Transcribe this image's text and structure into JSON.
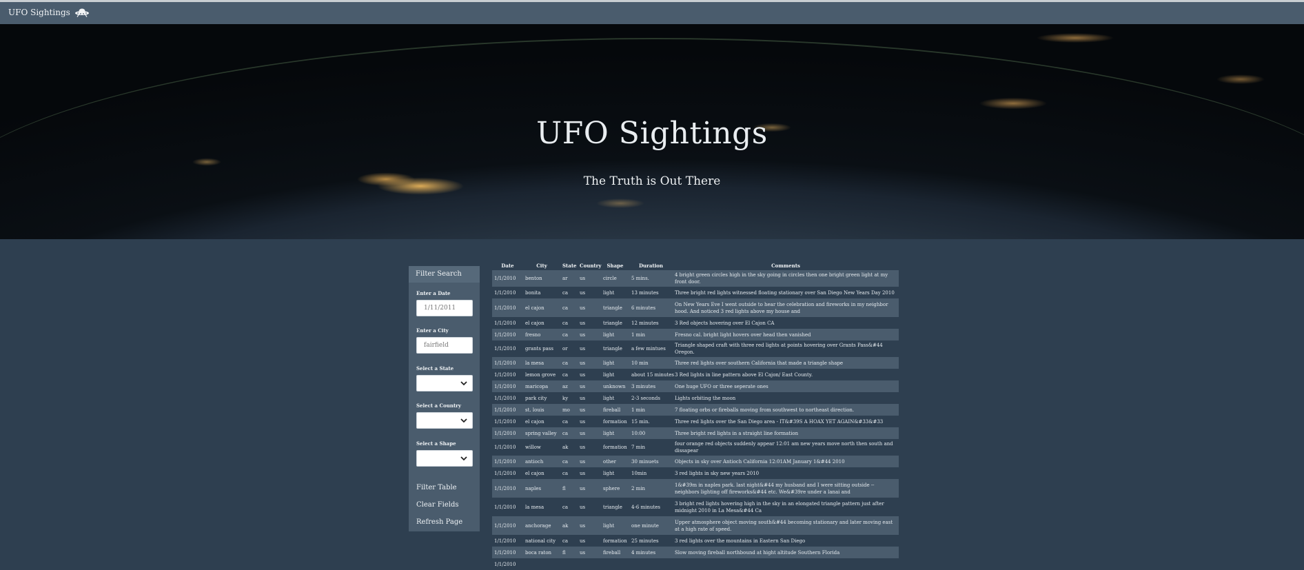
{
  "navbar": {
    "brand": "UFO Sightings",
    "brand_icon": "ufo-icon"
  },
  "hero": {
    "title": "UFO Sightings",
    "subtitle": "The Truth is Out There"
  },
  "filters": {
    "header": "Filter Search",
    "date_label": "Enter a Date",
    "date_placeholder": "1/11/2011",
    "city_label": "Enter a City",
    "city_placeholder": "fairfield",
    "state_label": "Select a State",
    "country_label": "Select a Country",
    "shape_label": "Select a Shape",
    "filter_table": "Filter Table",
    "clear_fields": "Clear Fields",
    "refresh_page": "Refresh Page"
  },
  "table": {
    "headers": [
      "Date",
      "City",
      "State",
      "Country",
      "Shape",
      "Duration",
      "Comments"
    ],
    "rows": [
      [
        "1/1/2010",
        "benton",
        "ar",
        "us",
        "circle",
        "5 mins.",
        "4 bright green circles high in the sky going in circles then one bright green light at my front door."
      ],
      [
        "1/1/2010",
        "bonita",
        "ca",
        "us",
        "light",
        "13 minutes",
        "Three bright red lights witnessed floating stationary over San Diego New Years Day 2010"
      ],
      [
        "1/1/2010",
        "el cajon",
        "ca",
        "us",
        "triangle",
        "6 minutes",
        "On New Years Eve I went outside to hear the celebration and fireworks in my neighbor hood. And noticed 3 red lights above my house and"
      ],
      [
        "1/1/2010",
        "el cajon",
        "ca",
        "us",
        "triangle",
        "12 minutes",
        "3 Red objects hovering over El Cajon CA"
      ],
      [
        "1/1/2010",
        "fresno",
        "ca",
        "us",
        "light",
        "1 min",
        "Fresno cal. bright light hovers over head then vanished"
      ],
      [
        "1/1/2010",
        "grants pass",
        "or",
        "us",
        "triangle",
        "a few mintues",
        "Triangle shaped craft with three red lights at points hovering over Grants Pass&#44 Oregon."
      ],
      [
        "1/1/2010",
        "la mesa",
        "ca",
        "us",
        "light",
        "10 min",
        "Three red lights over southern California that made a triangle shape"
      ],
      [
        "1/1/2010",
        "lemon grove",
        "ca",
        "us",
        "light",
        "about 15 minutes",
        "3 Red lights in line pattern above El Cajon/ East County."
      ],
      [
        "1/1/2010",
        "maricopa",
        "az",
        "us",
        "unknown",
        "3 minutes",
        "One huge UFO or three seperate ones"
      ],
      [
        "1/1/2010",
        "park city",
        "ky",
        "us",
        "light",
        "2-3 seconds",
        "Lights orbiting the moon"
      ],
      [
        "1/1/2010",
        "st. louis",
        "mo",
        "us",
        "fireball",
        "1 min",
        "7 floating orbs or fireballs moving from southwest to northeast direction."
      ],
      [
        "1/1/2010",
        "el cajon",
        "ca",
        "us",
        "formation",
        "15 min.",
        "Three red lights over the San Diego area - IT&#39S A HOAX YET AGAIN&#33&#33"
      ],
      [
        "1/1/2010",
        "spring valley",
        "ca",
        "us",
        "light",
        "10:00",
        "Three bright red lights in a straight line formation"
      ],
      [
        "1/1/2010",
        "willow",
        "ak",
        "us",
        "formation",
        "7 min",
        "four orange red objects suddenly appear 12:01 am new years move north then south and dissapear"
      ],
      [
        "1/1/2010",
        "antioch",
        "ca",
        "us",
        "other",
        "30 minuets",
        "Objects in sky over Antioch California 12:01AM January 1&#44 2010"
      ],
      [
        "1/1/2010",
        "el cajon",
        "ca",
        "us",
        "light",
        "10min",
        "3 red lights in sky new years 2010"
      ],
      [
        "1/1/2010",
        "naples",
        "fl",
        "us",
        "sphere",
        "2 min",
        "1&#39m in naples park. last night&#44 my husband and I were sitting outside --neighbors lighting off fireworks&#44 etc. We&#39re under a lanai and"
      ],
      [
        "1/1/2010",
        "la mesa",
        "ca",
        "us",
        "triangle",
        "4-6 minutes",
        "3 bright red lights hovering high in the sky in an elongated triangle pattern just after midnight 2010 in La Mesa&#44 Ca"
      ],
      [
        "1/1/2010",
        "anchorage",
        "ak",
        "us",
        "light",
        "one minute",
        "Upper atmosphere object moving south&#44 becoming stationary and later moving east at a high rate of speed."
      ],
      [
        "1/1/2010",
        "national city",
        "ca",
        "us",
        "formation",
        "25 minutes",
        "3 red lights over the mountains in Eastern San Diego"
      ],
      [
        "1/1/2010",
        "boca raton",
        "fl",
        "us",
        "fireball",
        "4 minutes",
        "Slow moving fireball northbound at hight altitude Southern Florida"
      ],
      [
        "1/1/2010",
        "",
        "",
        "",
        "",
        "",
        ""
      ]
    ]
  }
}
